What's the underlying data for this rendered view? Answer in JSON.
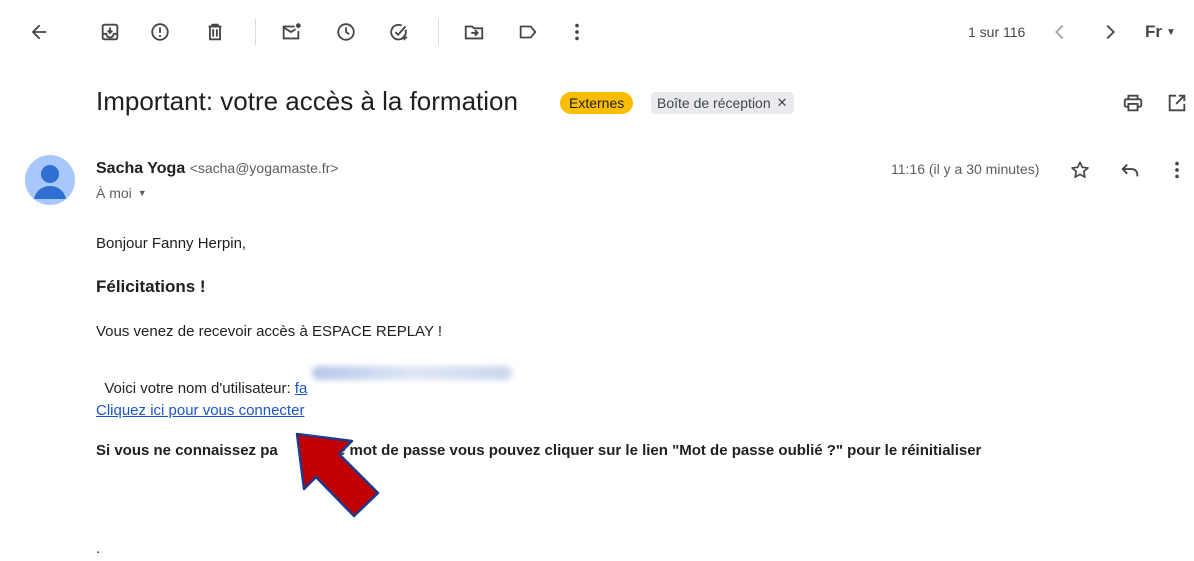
{
  "toolbar": {
    "back_icon": "arrow-left-icon",
    "archive_icon": "archive-icon",
    "spam_icon": "report-spam-icon",
    "delete_icon": "trash-icon",
    "unread_icon": "mark-unread-icon",
    "snooze_icon": "snooze-clock-icon",
    "task_icon": "add-task-icon",
    "move_icon": "move-to-folder-icon",
    "label_icon": "label-icon",
    "more_icon": "more-vertical-icon",
    "pagination": "1 sur 116",
    "prev_icon": "chevron-left-icon",
    "next_icon": "chevron-right-icon",
    "language": "Fr"
  },
  "email": {
    "subject": "Important: votre accès à la formation",
    "labels": [
      {
        "text": "Externes",
        "color": "#fbbc04"
      },
      {
        "text": "Boîte de réception",
        "removable": true
      }
    ],
    "sender_name": "Sacha Yoga",
    "sender_email": "<sacha@yogamaste.fr>",
    "recipient": "À moi",
    "time": "11:16 (il y a 30 minutes)",
    "body": {
      "greeting": "Bonjour Fanny Herpin,",
      "congrats": "Félicitations !",
      "access_line": "Vous venez de recevoir accès à ESPACE REPLAY !",
      "username_prefix": "Voici votre nom d'utilisateur: ",
      "username_visible": "fa",
      "login_link": "Cliquez ici pour vous connecter",
      "reset_before": "Si vous ne connaissez pa",
      "reset_after": "e mot de passe vous pouvez cliquer sur le lien \"Mot de passe oublié ?\" pour le réinitialiser",
      "trailing": "."
    }
  },
  "annotation": {
    "arrow_color": "#c00000",
    "arrow_outline": "#1f3a8a"
  }
}
